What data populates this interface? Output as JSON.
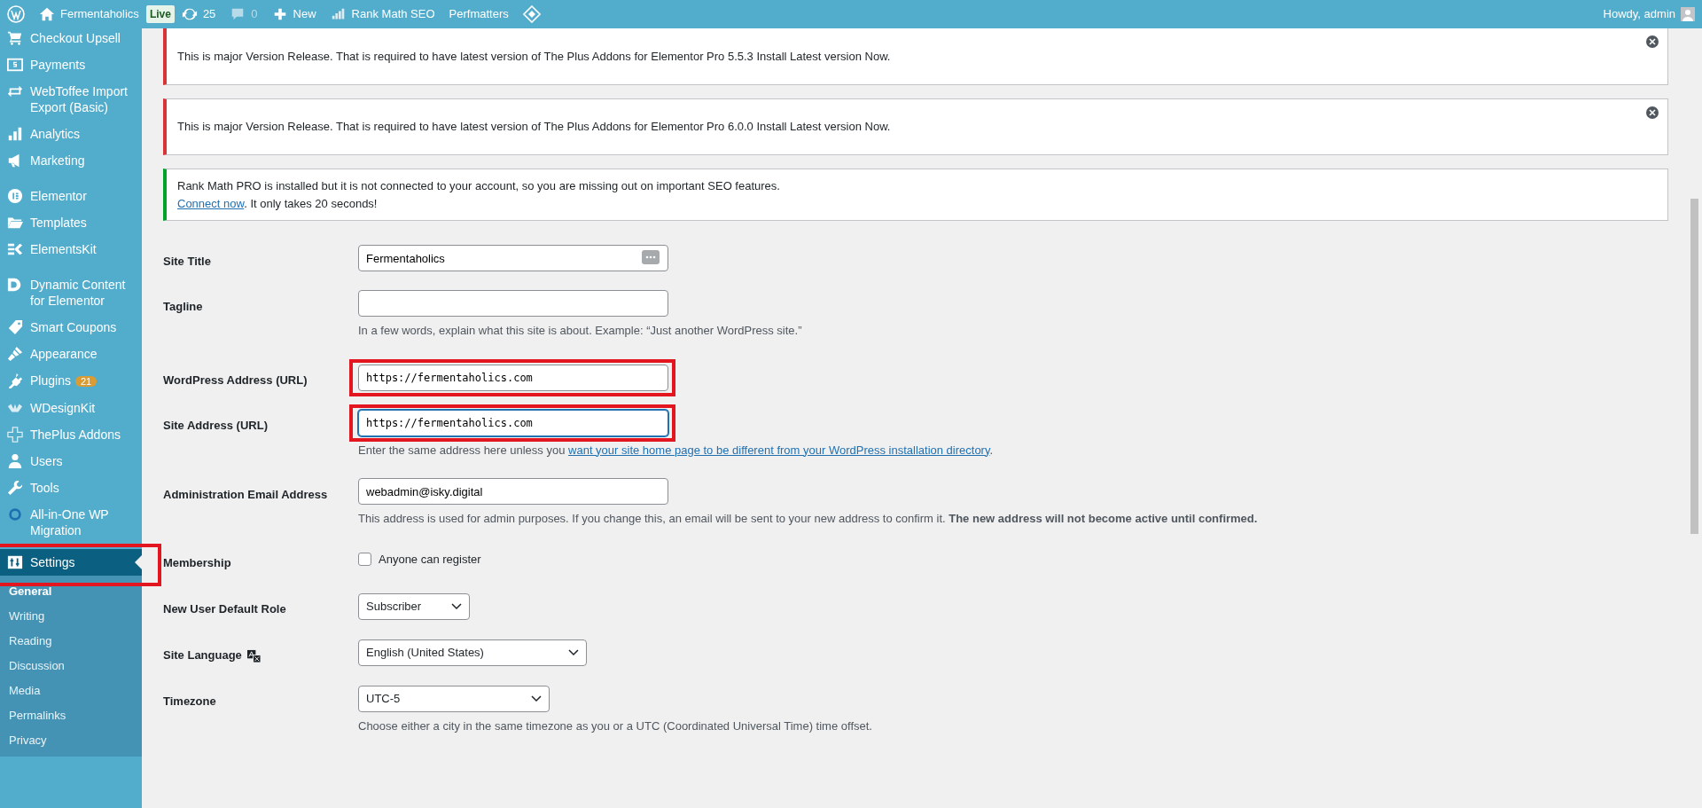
{
  "admin_bar": {
    "site": "Fermentaholics",
    "live_badge": "Live",
    "updates": "25",
    "comments": "0",
    "new": "New",
    "rank_math": "Rank Math SEO",
    "perfmatters": "Perfmatters",
    "howdy": "Howdy, admin"
  },
  "sidebar": {
    "items": [
      {
        "label": "Checkout Upsell",
        "selected": false,
        "annotated": false
      },
      {
        "label": "Payments",
        "selected": false,
        "annotated": false
      },
      {
        "label": "WebToffee Import Export (Basic)",
        "selected": false,
        "annotated": false
      },
      {
        "label": "Analytics",
        "selected": false,
        "annotated": false
      },
      {
        "label": "Marketing",
        "selected": false,
        "annotated": false
      },
      {
        "label": "Elementor",
        "selected": false,
        "annotated": false
      },
      {
        "label": "Templates",
        "selected": false,
        "annotated": false
      },
      {
        "label": "ElementsKit",
        "selected": false,
        "annotated": false
      },
      {
        "label": "Dynamic Content for Elementor",
        "selected": false,
        "annotated": false
      },
      {
        "label": "Smart Coupons",
        "selected": false,
        "annotated": false
      },
      {
        "label": "Appearance",
        "selected": false,
        "annotated": false
      },
      {
        "label": "Plugins",
        "badge": "21",
        "selected": false,
        "annotated": false
      },
      {
        "label": "WDesignKit",
        "selected": false,
        "annotated": false
      },
      {
        "label": "ThePlus Addons",
        "selected": false,
        "annotated": false
      },
      {
        "label": "Users",
        "selected": false,
        "annotated": false
      },
      {
        "label": "Tools",
        "selected": false,
        "annotated": false
      },
      {
        "label": "All-in-One WP Migration",
        "selected": false,
        "annotated": false
      },
      {
        "label": "Settings",
        "selected": true,
        "annotated": true,
        "children": [
          {
            "label": "General",
            "selected": true
          },
          {
            "label": "Writing",
            "selected": false
          },
          {
            "label": "Reading",
            "selected": false
          },
          {
            "label": "Discussion",
            "selected": false
          },
          {
            "label": "Media",
            "selected": false
          },
          {
            "label": "Permalinks",
            "selected": false
          },
          {
            "label": "Privacy",
            "selected": false
          }
        ]
      }
    ]
  },
  "notices": [
    {
      "kind": "error",
      "text": "This is major Version Release. That is required to have latest version of The Plus Addons for Elementor Pro 5.5.3 Install Latest version Now.",
      "dismissible": true
    },
    {
      "kind": "error",
      "text": "This is major Version Release. That is required to have latest version of The Plus Addons for Elementor Pro 6.0.0 Install Latest version Now.",
      "dismissible": true
    },
    {
      "kind": "success",
      "text": "Rank Math PRO is installed but it is not connected to your account, so you are missing out on important SEO features.",
      "link": "Connect now",
      "after": ". It only takes 20 seconds!",
      "dismissible": false
    }
  ],
  "form": [
    {
      "label": "Site Title",
      "kind": "text",
      "value": "Fermentaholics",
      "annotated": false,
      "focused": false
    },
    {
      "label": "Tagline",
      "kind": "text",
      "help": "In a few words, explain what this site is about. Example: “Just another WordPress site.”",
      "annotated": false,
      "focused": false
    },
    {
      "label": "WordPress Address (URL)",
      "kind": "url",
      "value": "https://fermentaholics.com",
      "annotated": true,
      "focused": false
    },
    {
      "label": "Site Address (URL)",
      "kind": "url",
      "value": "https://fermentaholics.com",
      "help": "Enter the same address here unless you ",
      "help_link": "want your site home page to be different from your WordPress installation directory",
      "help_after": ".",
      "annotated": true,
      "focused": true
    },
    {
      "label": "Administration Email Address",
      "kind": "text",
      "value": "webadmin@isky.digital",
      "help": "This address is used for admin purposes. If you change this, an email will be sent to your new address to confirm it. **The new address will not become active until confirmed.**",
      "annotated": false,
      "focused": false
    },
    {
      "label": "Membership",
      "kind": "checkbox",
      "option": "Anyone can register",
      "checked": false
    },
    {
      "label": "New User Default Role",
      "kind": "select",
      "value": "Subscriber"
    },
    {
      "label": "Site Language",
      "kind": "select",
      "value": "English (United States)"
    },
    {
      "label": "Timezone",
      "kind": "select",
      "value": "UTC-5",
      "help": "Choose either a city in the same timezone as you or a UTC (Coordinated Universal Time) time offset."
    }
  ]
}
